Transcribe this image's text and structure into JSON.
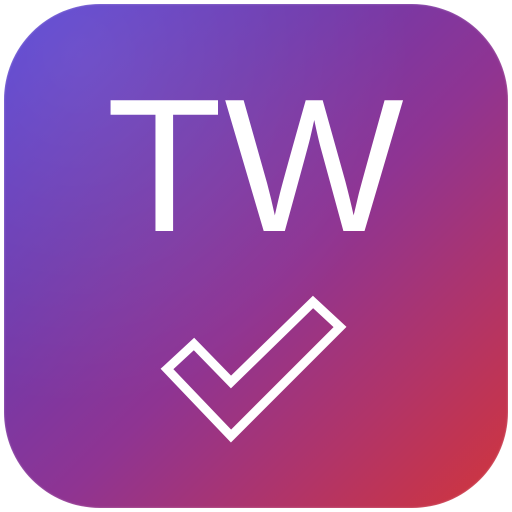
{
  "app_icon": {
    "monogram": "TW",
    "check_icon": "checkmark-outline-icon",
    "colors": {
      "gradient_start": "#5340d4",
      "gradient_mid": "#8f3492",
      "gradient_end": "#d2353a",
      "foreground": "#ffffff"
    }
  }
}
